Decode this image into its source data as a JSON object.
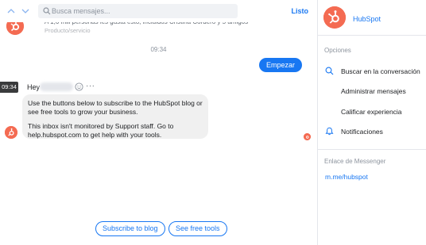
{
  "topbar": {
    "search_placeholder": "Busca mensajes...",
    "done_label": "Listo"
  },
  "previous_card": {
    "line1": "A 1,6 mill personas les gusta esto, incluidos Cristina Cordero y 5 amigos",
    "line2": "Producto/servicio"
  },
  "chat": {
    "time_divider": "09:34",
    "user_message": "Empezar",
    "hover_timestamp": "09:34",
    "greeting": "Hey",
    "more_label": "···",
    "bot_message_p1": "Use the buttons below to subscribe to the HubSpot blog or see free tools to grow your business.",
    "bot_message_p2": "This inbox isn't monitored by Support staff. Go to help.hubspot.com to get help with your tools."
  },
  "quick_replies": [
    {
      "label": "Subscribe to blog"
    },
    {
      "label": "See free tools"
    }
  ],
  "info_panel": {
    "page_name": "HubSpot",
    "options_heading": "Opciones",
    "options": [
      {
        "label": "Buscar en la conversación",
        "icon": "search-icon"
      },
      {
        "label": "Administrar mensajes",
        "icon": ""
      },
      {
        "label": "Calificar experiencia",
        "icon": ""
      },
      {
        "label": "Notificaciones",
        "icon": "bell-icon"
      }
    ],
    "messenger_link_heading": "Enlace de Messenger",
    "messenger_link": "m.me/hubspot"
  },
  "colors": {
    "accent": "#1877f2",
    "brand": "#f46b52"
  }
}
